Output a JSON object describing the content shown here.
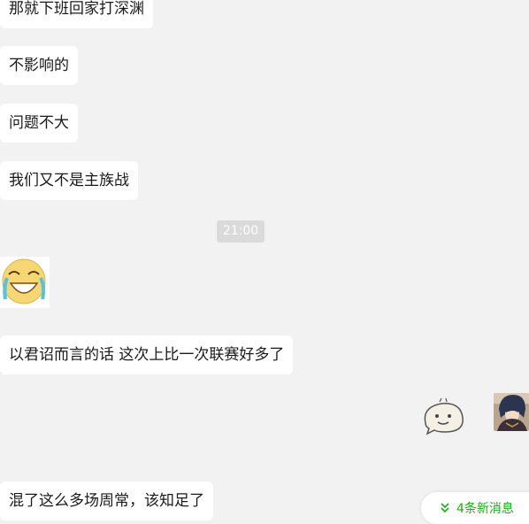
{
  "messages": [
    {
      "text": "那就下班回家打深渊"
    },
    {
      "text": "不影响的"
    },
    {
      "text": "问题不大"
    },
    {
      "text": "我们又不是主族战"
    },
    {
      "text": "以君诏而言的话 这次上比一次联赛好多了"
    },
    {
      "text": "混了这么多场周常，该知足了"
    }
  ],
  "timestamp": "21:00",
  "new_messages_label": "4条新消息",
  "colors": {
    "background": "#f2f2f2",
    "bubble": "#ffffff",
    "accent_green": "#1aad19",
    "time_badge": "#dadada"
  }
}
